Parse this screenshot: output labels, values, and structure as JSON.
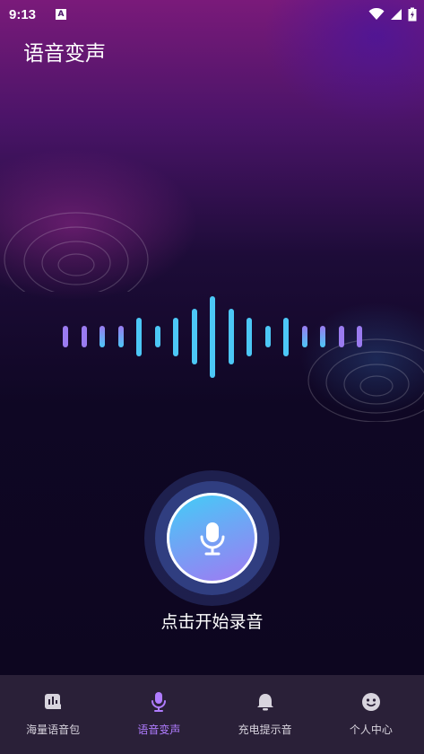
{
  "status_bar": {
    "time": "9:13",
    "notification_icon": "A",
    "icons": [
      "wifi-icon",
      "signal-icon",
      "battery-charging-icon"
    ]
  },
  "header": {
    "title": "语音变声"
  },
  "waveform": {
    "bar_levels": [
      0.25,
      0.25,
      0.25,
      0.25,
      0.45,
      0.25,
      0.45,
      0.65,
      0.95,
      0.65,
      0.45,
      0.25,
      0.45,
      0.25,
      0.25,
      0.25,
      0.25
    ],
    "colors": {
      "outer": "#9a7bf0",
      "inner": "#4cc7f6"
    }
  },
  "record": {
    "icon": "microphone-icon",
    "label": "点击开始录音"
  },
  "tab_bar": {
    "active_index": 1,
    "active_color": "#b07cff",
    "tabs": [
      {
        "label": "海量语音包",
        "icon": "voice-pack-icon"
      },
      {
        "label": "语音变声",
        "icon": "microphone-icon"
      },
      {
        "label": "充电提示音",
        "icon": "bell-icon"
      },
      {
        "label": "个人中心",
        "icon": "face-icon"
      }
    ]
  }
}
